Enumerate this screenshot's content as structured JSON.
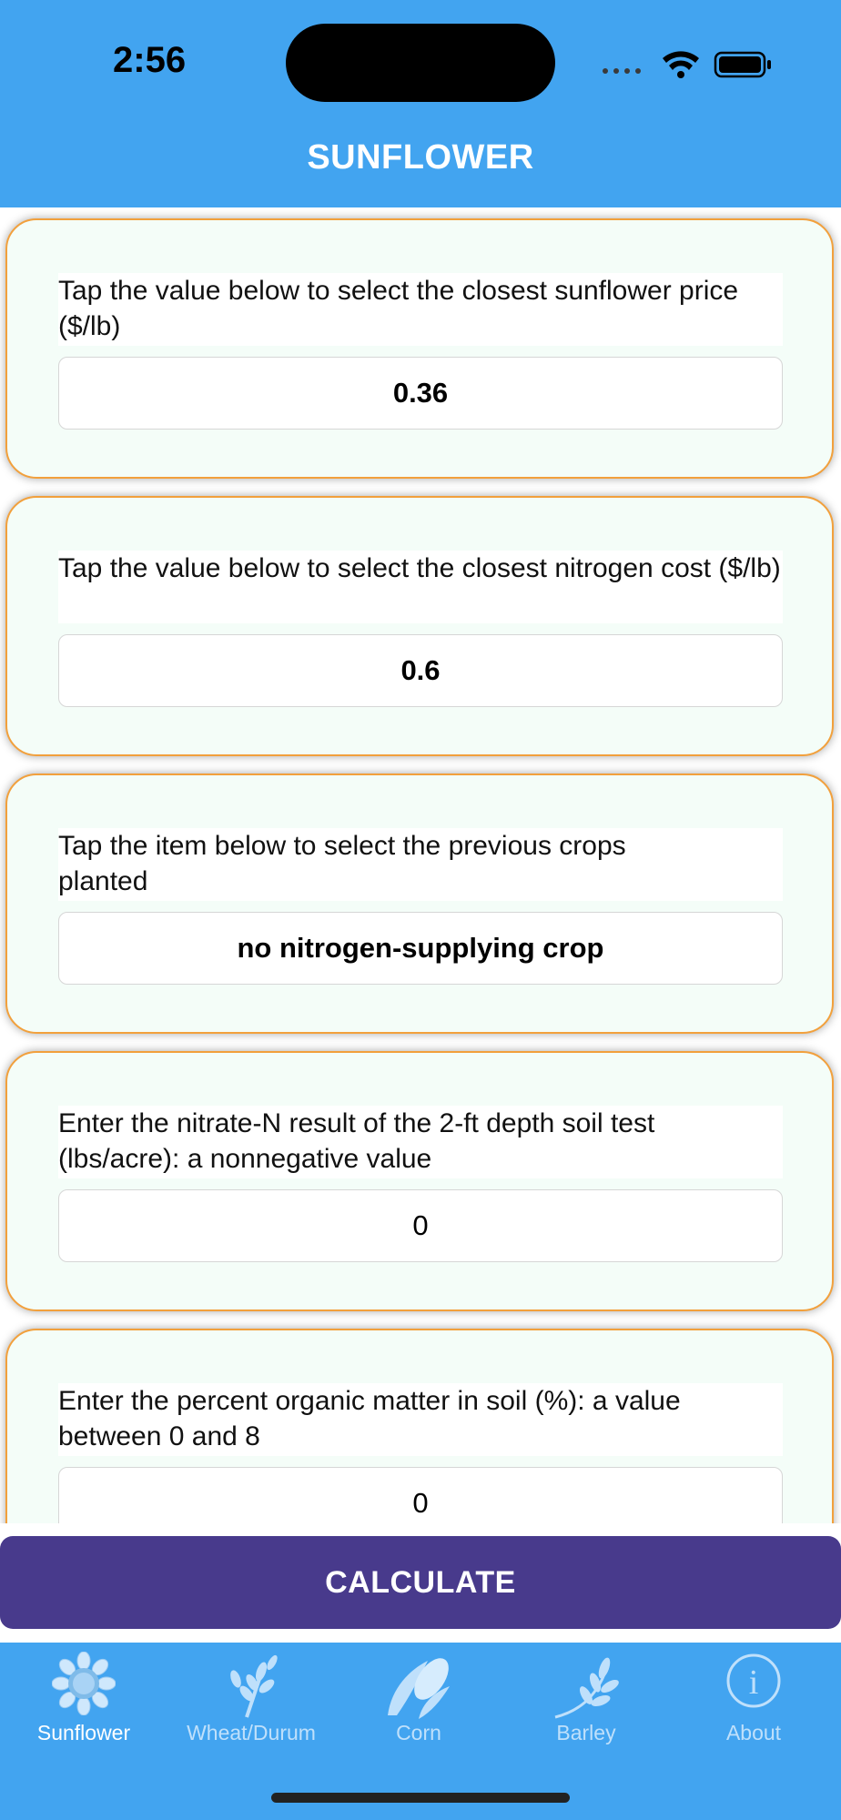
{
  "status": {
    "time": "2:56"
  },
  "header": {
    "title": "SUNFLOWER"
  },
  "cards": [
    {
      "prompt": "Tap the value below to select the closest sunflower price ($/lb)",
      "value": "0.36"
    },
    {
      "prompt": "Tap the value below to select the closest nitrogen cost ($/lb)",
      "value": "0.6"
    },
    {
      "prompt": "Tap the item below to select the previous crops planted",
      "value": "no nitrogen-supplying crop"
    },
    {
      "prompt": "Enter the nitrate-N result of the 2-ft depth soil test (lbs/acre): a nonnegative value",
      "value": "0"
    },
    {
      "prompt": "Enter the percent organic matter in soil (%): a value between 0 and 8",
      "value": "0"
    }
  ],
  "calculate_label": "CALCULATE",
  "tabs": [
    {
      "label": "Sunflower",
      "icon": "sunflower-icon",
      "active": true
    },
    {
      "label": "Wheat/Durum",
      "icon": "wheat-icon",
      "active": false
    },
    {
      "label": "Corn",
      "icon": "corn-icon",
      "active": false
    },
    {
      "label": "Barley",
      "icon": "barley-icon",
      "active": false
    },
    {
      "label": "About",
      "icon": "info-icon",
      "active": false
    }
  ],
  "colors": {
    "header": "#42a4f0",
    "card_border": "#f2a03c",
    "calculate": "#483a8c"
  }
}
